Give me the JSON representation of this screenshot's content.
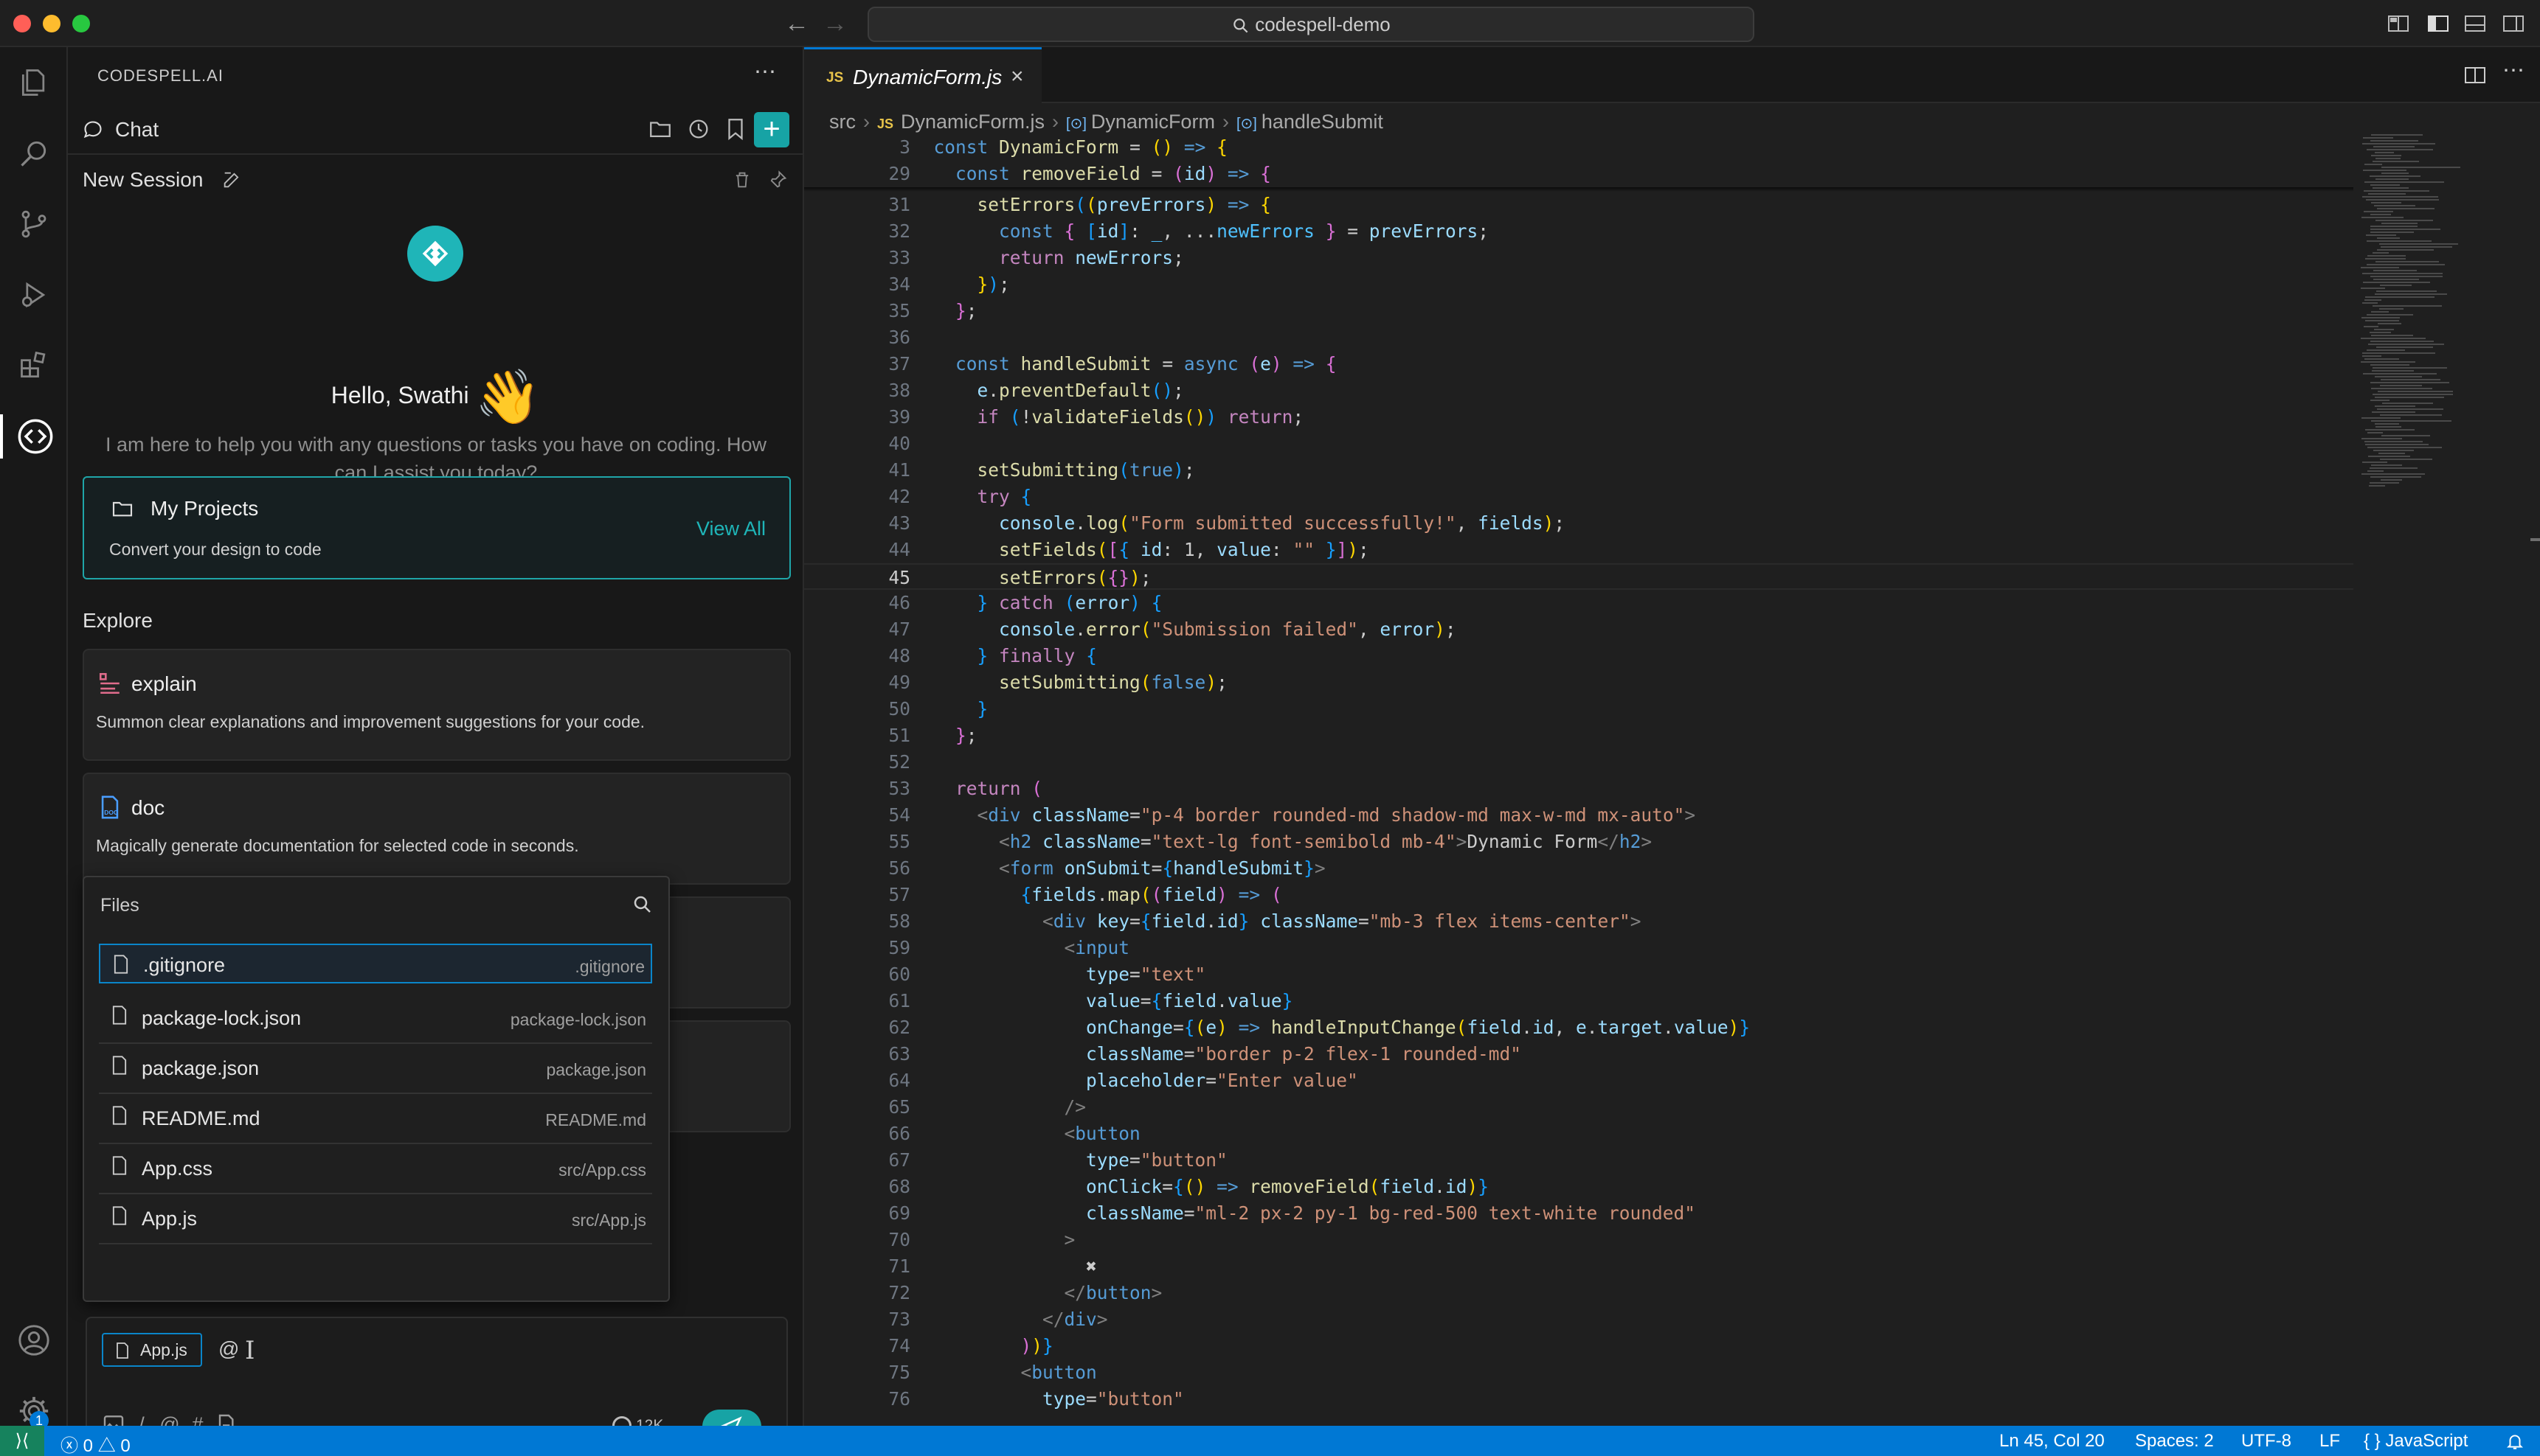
{
  "window": {
    "search_text": "codespell-demo"
  },
  "panel": {
    "title": "CODESPELL.AI",
    "chat_label": "Chat",
    "session_title": "New Session",
    "greeting": "Hello, Swathi",
    "greeting_emoji": "👋",
    "intro": "I am here to help you with any questions or tasks you have on coding. How can I assist you today?",
    "projects": {
      "title": "My Projects",
      "subtitle": "Convert your design to code",
      "link": "View All"
    },
    "explore_label": "Explore",
    "explore": [
      {
        "title": "explain",
        "desc": "Summon clear explanations and improvement suggestions for your code.",
        "icon": "explain-icon"
      },
      {
        "title": "doc",
        "desc": "Magically generate documentation for selected code in seconds.",
        "icon": "doc-icon"
      }
    ],
    "files_popup": {
      "label": "Files",
      "items": [
        {
          "name": ".gitignore",
          "path": ".gitignore"
        },
        {
          "name": "package-lock.json",
          "path": "package-lock.json"
        },
        {
          "name": "package.json",
          "path": "package.json"
        },
        {
          "name": "README.md",
          "path": "README.md"
        },
        {
          "name": "App.css",
          "path": "src/App.css"
        },
        {
          "name": "App.js",
          "path": "src/App.js"
        }
      ]
    },
    "input": {
      "context_chip": "App.js",
      "typed": "@",
      "token_label": "12K",
      "tools": [
        "/",
        "@",
        "#"
      ]
    }
  },
  "activity_bar": {
    "settings_badge": "1"
  },
  "editor": {
    "tab": {
      "lang": "JS",
      "name": "DynamicForm.js"
    },
    "breadcrumb": [
      "src",
      "DynamicForm.js",
      "DynamicForm",
      "handleSubmit"
    ],
    "current_line": 45,
    "lines": [
      {
        "n": "3",
        "h": "  <span class=\"k\">const</span> <span class=\"f\">DynamicForm</span> = <span class=\"p\">()</span> <span class=\"k\">=&gt;</span> <span class=\"p\">{</span>"
      },
      {
        "n": "29",
        "h": "    <span class=\"k\">const</span> <span class=\"f\">removeField</span> = <span class=\"p2\">(</span><span class=\"v\">id</span><span class=\"p2\">)</span> <span class=\"k\">=&gt;</span> <span class=\"p2\">{</span>"
      },
      {
        "n": "31",
        "h": "      <span class=\"f\">setErrors</span><span class=\"p3\">(</span><span class=\"p\">(</span><span class=\"v\">prevErrors</span><span class=\"p\">)</span> <span class=\"k\">=&gt;</span> <span class=\"p\">{</span>"
      },
      {
        "n": "32",
        "h": "        <span class=\"k\">const</span> <span class=\"p2\">{</span> <span class=\"p3\">[</span><span class=\"v\">id</span><span class=\"p3\">]</span>: <span class=\"c\">_</span>, ...<span class=\"c\">newErrors</span> <span class=\"p2\">}</span> = <span class=\"v\">prevErrors</span>;"
      },
      {
        "n": "33",
        "h": "        <span class=\"kw\">return</span> <span class=\"v\">newErrors</span>;"
      },
      {
        "n": "34",
        "h": "      <span class=\"p\">}</span><span class=\"p3\">)</span>;"
      },
      {
        "n": "35",
        "h": "    <span class=\"p2\">}</span>;"
      },
      {
        "n": "36",
        "h": ""
      },
      {
        "n": "37",
        "h": "    <span class=\"k\">const</span> <span class=\"f\">handleSubmit</span> = <span class=\"k\">async</span> <span class=\"p2\">(</span><span class=\"v\">e</span><span class=\"p2\">)</span> <span class=\"k\">=&gt;</span> <span class=\"p2\">{</span>"
      },
      {
        "n": "38",
        "h": "      <span class=\"v\">e</span>.<span class=\"f\">preventDefault</span><span class=\"p3\">()</span>;"
      },
      {
        "n": "39",
        "h": "      <span class=\"kw\">if</span> <span class=\"p3\">(</span>!<span class=\"f\">validateFields</span><span class=\"p\">()</span><span class=\"p3\">)</span> <span class=\"kw\">return</span>;"
      },
      {
        "n": "40",
        "h": ""
      },
      {
        "n": "41",
        "h": "      <span class=\"f\">setSubmitting</span><span class=\"p3\">(</span><span class=\"k\">true</span><span class=\"p3\">)</span>;"
      },
      {
        "n": "42",
        "h": "      <span class=\"kw\">try</span> <span class=\"p3\">{</span>"
      },
      {
        "n": "43",
        "h": "        <span class=\"v\">console</span>.<span class=\"f\">log</span><span class=\"p\">(</span><span class=\"s\">\"Form submitted successfully!\"</span>, <span class=\"v\">fields</span><span class=\"p\">)</span>;"
      },
      {
        "n": "44",
        "h": "        <span class=\"f\">setFields</span><span class=\"p\">(</span><span class=\"p2\">[</span><span class=\"p3\">{</span> <span class=\"v\">id</span>: <span class=\"n\">1</span>, <span class=\"v\">value</span>: <span class=\"s\">\"\"</span> <span class=\"p3\">}</span><span class=\"p2\">]</span><span class=\"p\">)</span>;"
      },
      {
        "n": "45",
        "h": "        <span class=\"f\">setErrors</span><span class=\"p\">(</span><span class=\"p2\">{}</span><span class=\"p\">)</span>;"
      },
      {
        "n": "46",
        "h": "      <span class=\"p3\">}</span> <span class=\"kw\">catch</span> <span class=\"p3\">(</span><span class=\"v\">error</span><span class=\"p3\">)</span> <span class=\"p3\">{</span>"
      },
      {
        "n": "47",
        "h": "        <span class=\"v\">console</span>.<span class=\"f\">error</span><span class=\"p\">(</span><span class=\"s\">\"Submission failed\"</span>, <span class=\"v\">error</span><span class=\"p\">)</span>;"
      },
      {
        "n": "48",
        "h": "      <span class=\"p3\">}</span> <span class=\"kw\">finally</span> <span class=\"p3\">{</span>"
      },
      {
        "n": "49",
        "h": "        <span class=\"f\">setSubmitting</span><span class=\"p\">(</span><span class=\"k\">false</span><span class=\"p\">)</span>;"
      },
      {
        "n": "50",
        "h": "      <span class=\"p3\">}</span>"
      },
      {
        "n": "51",
        "h": "    <span class=\"p2\">}</span>;"
      },
      {
        "n": "52",
        "h": ""
      },
      {
        "n": "53",
        "h": "    <span class=\"kw\">return</span> <span class=\"p2\">(</span>"
      },
      {
        "n": "54",
        "h": "      <span class=\"tg\">&lt;</span><span class=\"t\">div</span> <span class=\"a\">className</span>=<span class=\"s\">\"p-4 border rounded-md shadow-md max-w-md mx-auto\"</span><span class=\"tg\">&gt;</span>"
      },
      {
        "n": "55",
        "h": "        <span class=\"tg\">&lt;</span><span class=\"t\">h2</span> <span class=\"a\">className</span>=<span class=\"s\">\"text-lg font-semibold mb-4\"</span><span class=\"tg\">&gt;</span>Dynamic Form<span class=\"tg\">&lt;/</span><span class=\"t\">h2</span><span class=\"tg\">&gt;</span>"
      },
      {
        "n": "56",
        "h": "        <span class=\"tg\">&lt;</span><span class=\"t\">form</span> <span class=\"a\">onSubmit</span>=<span class=\"p3\">{</span><span class=\"v\">handleSubmit</span><span class=\"p3\">}</span><span class=\"tg\">&gt;</span>"
      },
      {
        "n": "57",
        "h": "          <span class=\"p3\">{</span><span class=\"v\">fields</span>.<span class=\"f\">map</span><span class=\"p\">(</span><span class=\"p2\">(</span><span class=\"v\">field</span><span class=\"p2\">)</span> <span class=\"k\">=&gt;</span> <span class=\"p2\">(</span>"
      },
      {
        "n": "58",
        "h": "            <span class=\"tg\">&lt;</span><span class=\"t\">div</span> <span class=\"a\">key</span>=<span class=\"p3\">{</span><span class=\"v\">field</span>.<span class=\"v\">id</span><span class=\"p3\">}</span> <span class=\"a\">className</span>=<span class=\"s\">\"mb-3 flex items-center\"</span><span class=\"tg\">&gt;</span>"
      },
      {
        "n": "59",
        "h": "              <span class=\"tg\">&lt;</span><span class=\"t\">input</span>"
      },
      {
        "n": "60",
        "h": "                <span class=\"a\">type</span>=<span class=\"s\">\"text\"</span>"
      },
      {
        "n": "61",
        "h": "                <span class=\"a\">value</span>=<span class=\"p3\">{</span><span class=\"v\">field</span>.<span class=\"v\">value</span><span class=\"p3\">}</span>"
      },
      {
        "n": "62",
        "h": "                <span class=\"a\">onChange</span>=<span class=\"p3\">{</span><span class=\"p\">(</span><span class=\"v\">e</span><span class=\"p\">)</span> <span class=\"k\">=&gt;</span> <span class=\"f\">handleInputChange</span><span class=\"p\">(</span><span class=\"v\">field</span>.<span class=\"v\">id</span>, <span class=\"v\">e</span>.<span class=\"v\">target</span>.<span class=\"v\">value</span><span class=\"p\">)</span><span class=\"p3\">}</span>"
      },
      {
        "n": "63",
        "h": "                <span class=\"a\">className</span>=<span class=\"s\">\"border p-2 flex-1 rounded-md\"</span>"
      },
      {
        "n": "64",
        "h": "                <span class=\"a\">placeholder</span>=<span class=\"s\">\"Enter value\"</span>"
      },
      {
        "n": "65",
        "h": "              <span class=\"tg\">/&gt;</span>"
      },
      {
        "n": "66",
        "h": "              <span class=\"tg\">&lt;</span><span class=\"t\">button</span>"
      },
      {
        "n": "67",
        "h": "                <span class=\"a\">type</span>=<span class=\"s\">\"button\"</span>"
      },
      {
        "n": "68",
        "h": "                <span class=\"a\">onClick</span>=<span class=\"p3\">{</span><span class=\"p\">()</span> <span class=\"k\">=&gt;</span> <span class=\"f\">removeField</span><span class=\"p\">(</span><span class=\"v\">field</span>.<span class=\"v\">id</span><span class=\"p\">)</span><span class=\"p3\">}</span>"
      },
      {
        "n": "69",
        "h": "                <span class=\"a\">className</span>=<span class=\"s\">\"ml-2 px-2 py-1 bg-red-500 text-white rounded\"</span>"
      },
      {
        "n": "70",
        "h": "              <span class=\"tg\">&gt;</span>"
      },
      {
        "n": "71",
        "h": "                ✖"
      },
      {
        "n": "72",
        "h": "              <span class=\"tg\">&lt;/</span><span class=\"t\">button</span><span class=\"tg\">&gt;</span>"
      },
      {
        "n": "73",
        "h": "            <span class=\"tg\">&lt;/</span><span class=\"t\">div</span><span class=\"tg\">&gt;</span>"
      },
      {
        "n": "74",
        "h": "          <span class=\"p2\">)</span><span class=\"p\">)</span><span class=\"p3\">}</span>"
      },
      {
        "n": "75",
        "h": "          <span class=\"tg\">&lt;</span><span class=\"t\">button</span>"
      },
      {
        "n": "76",
        "h": "            <span class=\"a\">type</span>=<span class=\"s\">\"button\"</span>"
      }
    ]
  },
  "statusbar": {
    "errors": "0",
    "warnings": "0",
    "position": "Ln 45, Col 20",
    "spaces": "Spaces: 2",
    "encoding": "UTF-8",
    "eol": "LF",
    "language": "JavaScript"
  },
  "colors": {
    "accent": "#17a3a5",
    "status_bar": "#0078d4",
    "selection_border": "#0a85c9"
  }
}
